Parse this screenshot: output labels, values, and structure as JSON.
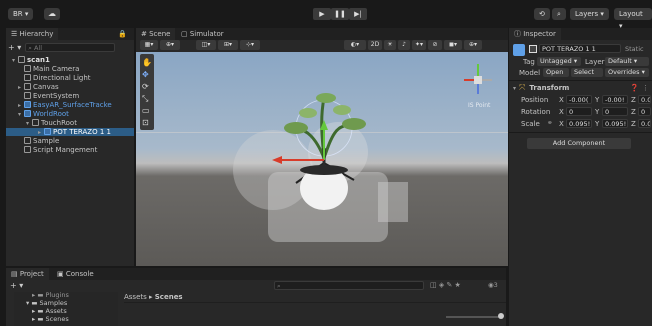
{
  "toolbar": {
    "account_label": "BR ▾",
    "play_icon": "play-icon",
    "pause_icon": "pause-icon",
    "step_icon": "step-icon",
    "layers_label": "Layers",
    "layout_label": "Layout"
  },
  "hierarchy": {
    "tab_label": "Hierarchy",
    "search_placeholder": "All",
    "items": [
      {
        "label": "scan1"
      },
      {
        "label": "Main Camera"
      },
      {
        "label": "Directional Light"
      },
      {
        "label": "Canvas"
      },
      {
        "label": "EventSystem"
      },
      {
        "label": "EasyAR_SurfaceTracke"
      },
      {
        "label": "WorldRoot"
      },
      {
        "label": "TouchRoot"
      },
      {
        "label": "POT TERAZO 1 1"
      },
      {
        "label": "Sample"
      },
      {
        "label": "Script Mangement"
      }
    ]
  },
  "scene": {
    "tabs": [
      {
        "label": "Scene"
      },
      {
        "label": "Simulator"
      }
    ],
    "toolbar_2d": "2D",
    "persp_label": "IS Point"
  },
  "inspector": {
    "tab_label": "Inspector",
    "object_name": "POT TERAZO 1 1",
    "static_label": "Static",
    "tag_label": "Tag",
    "tag_value": "Untagged",
    "layer_label": "Layer",
    "layer_value": "Default",
    "model_label": "Model",
    "open_label": "Open",
    "select_label": "Select",
    "overrides_label": "Overrides",
    "transform_label": "Transform",
    "position_label": "Position",
    "rotation_label": "Rotation",
    "scale_label": "Scale",
    "pos_x": "-0.00(",
    "pos_y": "-0.00!",
    "pos_z": "0.0(",
    "rot_x": "0",
    "rot_y": "0",
    "rot_z": "0",
    "scale_x": "0.095!",
    "scale_y": "0.095!",
    "scale_z": "0.0",
    "add_component_label": "Add Component"
  },
  "project": {
    "tabs": [
      {
        "label": "Project"
      },
      {
        "label": "Console"
      }
    ],
    "breadcrumb_root": "Assets",
    "breadcrumb_sep": "▸",
    "breadcrumb_current": "Scenes",
    "folders": [
      {
        "label": "Plugins"
      },
      {
        "label": "Samples"
      },
      {
        "label": "Assets"
      },
      {
        "label": "Scenes"
      }
    ],
    "count_label": "3"
  }
}
